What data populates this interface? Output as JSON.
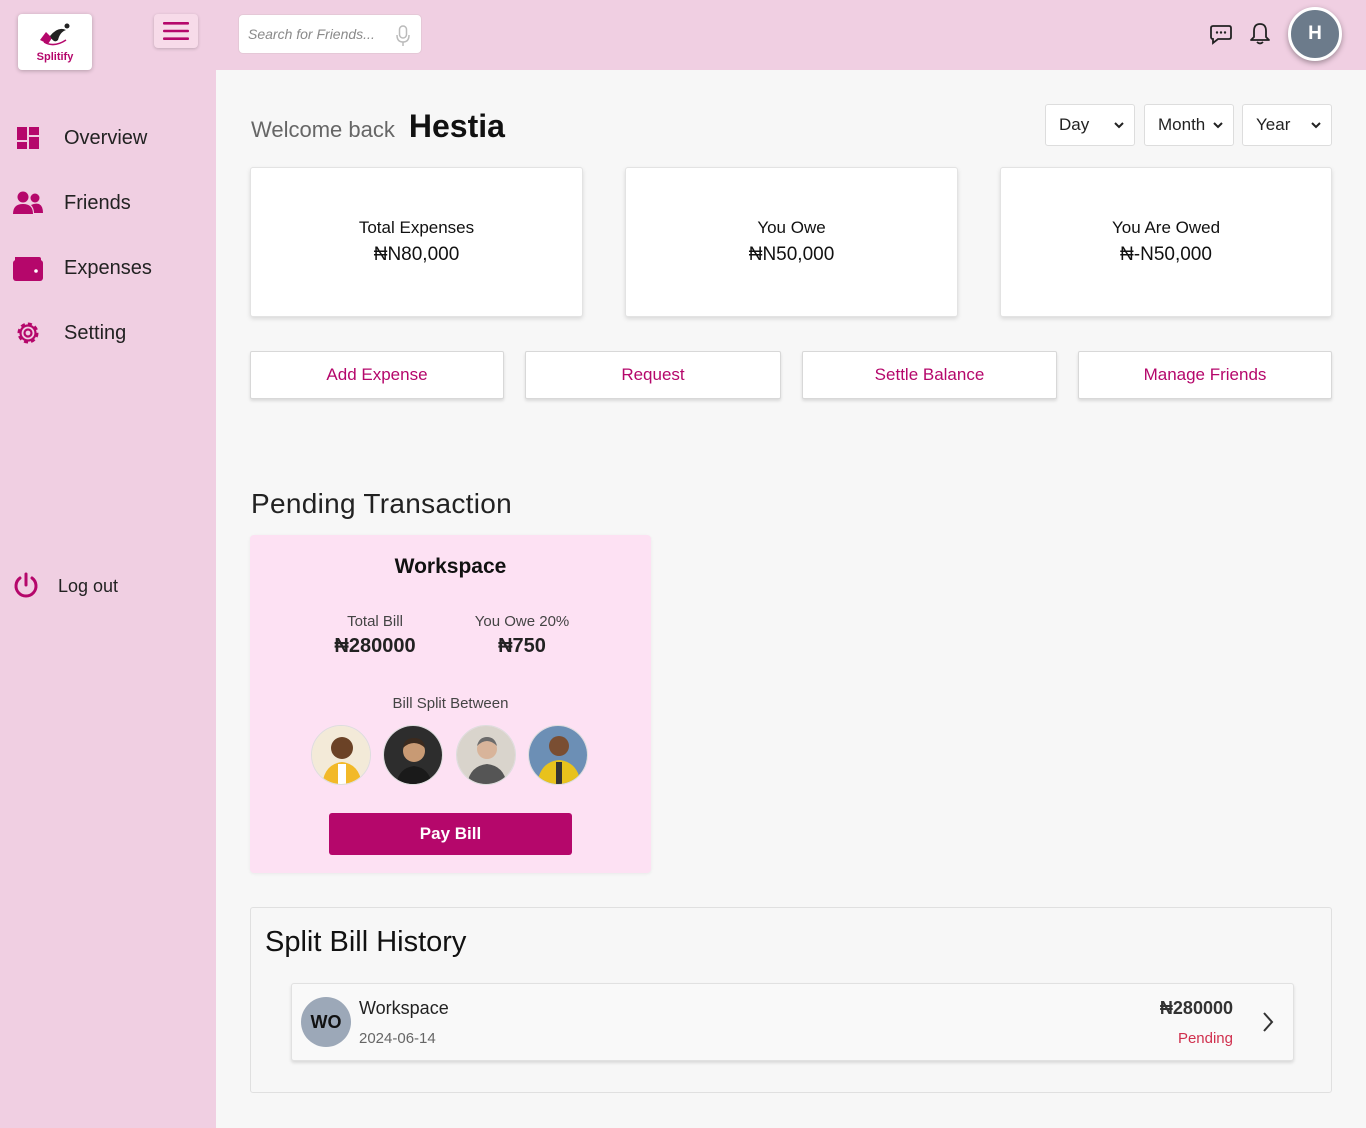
{
  "brand": {
    "name": "Splitify",
    "accent": "#b5076b",
    "sidebar_bg": "#f0cfe2"
  },
  "sidebar": {
    "items": [
      {
        "label": "Overview",
        "icon": "dashboard-icon"
      },
      {
        "label": "Friends",
        "icon": "users-icon"
      },
      {
        "label": "Expenses",
        "icon": "wallet-icon"
      },
      {
        "label": "Setting",
        "icon": "gear-icon"
      }
    ],
    "logout_label": "Log out"
  },
  "topbar": {
    "search_placeholder": "Search for Friends...",
    "user_initial": "H"
  },
  "welcome": {
    "greeting": "Welcome back",
    "name": "Hestia"
  },
  "filters": [
    "Day",
    "Month",
    "Year"
  ],
  "summary_cards": [
    {
      "title": "Total Expenses",
      "value": "₦N80,000"
    },
    {
      "title": "You Owe",
      "value": "₦N50,000"
    },
    {
      "title": "You Are Owed",
      "value": "₦-N50,000"
    }
  ],
  "actions": [
    "Add Expense",
    "Request",
    "Settle Balance",
    "Manage Friends"
  ],
  "pending": {
    "section_title": "Pending Transaction",
    "card_title": "Workspace",
    "total_bill_label": "Total Bill",
    "total_bill_value": "₦280000",
    "you_owe_label": "You Owe 20%",
    "you_owe_value": "₦750",
    "split_label": "Bill Split Between",
    "pay_label": "Pay Bill"
  },
  "history": {
    "section_title": "Split Bill History",
    "rows": [
      {
        "initials": "WO",
        "name": "Workspace",
        "date": "2024-06-14",
        "amount": "₦280000",
        "status": "Pending"
      }
    ]
  }
}
